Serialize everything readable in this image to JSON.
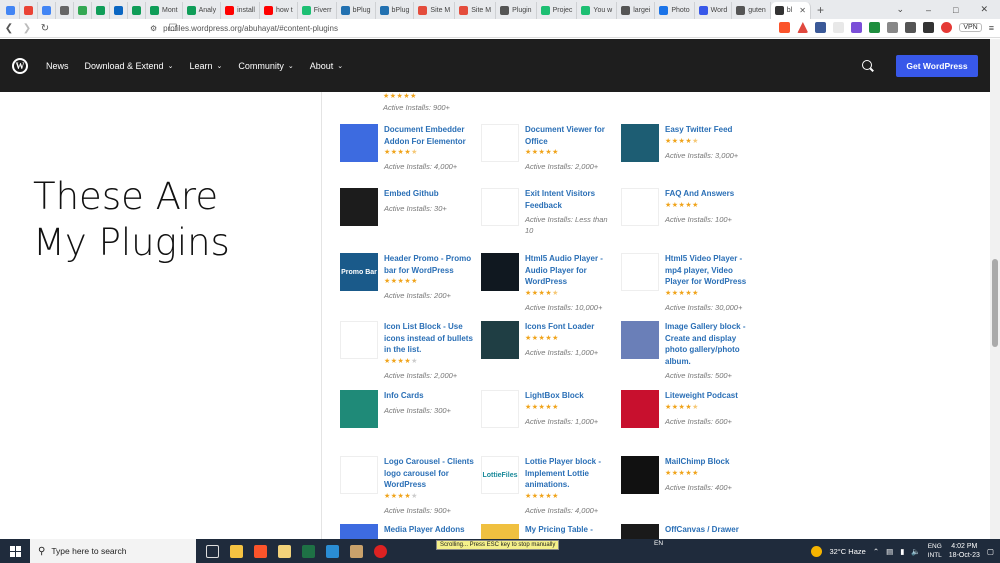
{
  "browser": {
    "tabs": [
      {
        "label": "",
        "color": "#4285f4"
      },
      {
        "label": "",
        "color": "#ea4335"
      },
      {
        "label": "",
        "color": "#4285f4"
      },
      {
        "label": "",
        "color": "#666666"
      },
      {
        "label": "",
        "color": "#34a853"
      },
      {
        "label": "",
        "color": "#0f9d58"
      },
      {
        "label": "",
        "color": "#0a66c2"
      },
      {
        "label": "",
        "color": "#0f9d58"
      },
      {
        "label": "Mont",
        "color": "#0f9d58"
      },
      {
        "label": "Analy",
        "color": "#0f9d58"
      },
      {
        "label": "install",
        "color": "#ff0000"
      },
      {
        "label": "how t",
        "color": "#ff0000"
      },
      {
        "label": "Fiverr",
        "color": "#1dbf73"
      },
      {
        "label": "bPlug",
        "color": "#2271b1"
      },
      {
        "label": "bPlug",
        "color": "#2271b1"
      },
      {
        "label": "Site M",
        "color": "#e44c3c"
      },
      {
        "label": "Site M",
        "color": "#e44c3c"
      },
      {
        "label": "Plugin",
        "color": "#555555"
      },
      {
        "label": "Projec",
        "color": "#1dbf73"
      },
      {
        "label": "You w",
        "color": "#1dbf73"
      },
      {
        "label": "largei",
        "color": "#555555"
      },
      {
        "label": "Photo",
        "color": "#1a73e8"
      },
      {
        "label": "Word",
        "color": "#3858e9"
      },
      {
        "label": "guten",
        "color": "#555555"
      },
      {
        "label": "bl",
        "color": "#333333",
        "active": true
      }
    ],
    "new_tab": "+",
    "url": "profiles.wordpress.org/abuhayat/#content-plugins",
    "vpn": "VPN"
  },
  "wp_nav": {
    "items": [
      {
        "label": "News",
        "dropdown": false
      },
      {
        "label": "Download & Extend",
        "dropdown": true
      },
      {
        "label": "Learn",
        "dropdown": true
      },
      {
        "label": "Community",
        "dropdown": true
      },
      {
        "label": "About",
        "dropdown": true
      }
    ],
    "cta": "Get WordPress"
  },
  "page": {
    "heading_line1": "These Are",
    "heading_line2": "My Plugins",
    "top_partial_installs": "Active Installs: 900+"
  },
  "plugins": [
    {
      "name": "Document Embedder Addon For Elementor",
      "stars": 4.5,
      "installs": "Active Installs: 4,000+",
      "icon": "document-embedder-icon",
      "color": "#3d6be0"
    },
    {
      "name": "Document Viewer for Office",
      "stars": 5,
      "installs": "Active Installs: 2,000+",
      "icon": "document-viewer-icon",
      "color": "#ffffff"
    },
    {
      "name": "Easy Twitter Feed",
      "stars": 4.5,
      "installs": "Active Installs: 3,000+",
      "icon": "twitter-feed-icon",
      "color": "#1d5d73"
    },
    {
      "name": "Embed Github",
      "stars": 0,
      "installs": "Active Installs: 30+",
      "icon": "github-icon",
      "color": "#1c1c1c"
    },
    {
      "name": "Exit Intent Visitors Feedback",
      "stars": 0,
      "installs": "Active Installs: Less than 10",
      "icon": "exit-intent-icon",
      "color": "#ffffff"
    },
    {
      "name": "FAQ And Answers",
      "stars": 5,
      "installs": "Active Installs: 100+",
      "icon": "faq-icon",
      "color": "#ffffff"
    },
    {
      "name": "Header Promo - Promo bar for WordPress",
      "stars": 5,
      "installs": "Active Installs: 200+",
      "icon": "promo-bar-icon",
      "color": "#1a5a8a",
      "icon_text": "Promo Bar"
    },
    {
      "name": "Html5 Audio Player - Audio Player for WordPress",
      "stars": 4.5,
      "installs": "Active Installs: 10,000+",
      "icon": "audio-player-icon",
      "color": "#101820"
    },
    {
      "name": "Html5 Video Player - mp4 player, Video Player for WordPress",
      "stars": 5,
      "installs": "Active Installs: 30,000+",
      "icon": "video-player-icon",
      "color": "#ffffff"
    },
    {
      "name": "Icon List Block - Use icons instead of bullets in the list.",
      "stars": 4,
      "installs": "Active Installs: 2,000+",
      "icon": "icon-list-icon",
      "color": "#ffffff"
    },
    {
      "name": "Icons Font Loader",
      "stars": 5,
      "installs": "Active Installs: 1,000+",
      "icon": "font-loader-icon",
      "color": "#1f3e44"
    },
    {
      "name": "Image Gallery block - Create and display photo gallery/photo album.",
      "stars": 0,
      "installs": "Active Installs: 500+",
      "icon": "image-gallery-icon",
      "color": "#6a7fb8"
    },
    {
      "name": "Info Cards",
      "stars": 0,
      "installs": "Active Installs: 300+",
      "icon": "info-cards-icon",
      "color": "#1f8a78"
    },
    {
      "name": "LightBox Block",
      "stars": 5,
      "installs": "Active Installs: 1,000+",
      "icon": "lightbox-icon",
      "color": "#ffffff"
    },
    {
      "name": "Liteweight Podcast",
      "stars": 4.5,
      "installs": "Active Installs: 600+",
      "icon": "podcast-icon",
      "color": "#c8102e"
    },
    {
      "name": "Logo Carousel - Clients logo carousel for WordPress",
      "stars": 4,
      "installs": "Active Installs: 900+",
      "icon": "logo-carousel-icon",
      "color": "#ffffff"
    },
    {
      "name": "Lottie Player block - Implement Lottie animations.",
      "stars": 5,
      "installs": "Active Installs: 4,000+",
      "icon": "lottie-icon",
      "color": "#ffffff",
      "icon_text": "LottieFiles"
    },
    {
      "name": "MailChimp Block",
      "stars": 5,
      "installs": "Active Installs: 400+",
      "icon": "mailchimp-icon",
      "color": "#111111"
    },
    {
      "name": "Media Player Addons",
      "stars": 0,
      "installs": "",
      "icon": "media-player-icon",
      "color": "#3d6be0"
    },
    {
      "name": "My Pricing Table -",
      "stars": 0,
      "installs": "",
      "icon": "pricing-table-icon",
      "color": "#f0c040"
    },
    {
      "name": "OffCanvas / Drawer",
      "stars": 0,
      "installs": "",
      "icon": "offcanvas-icon",
      "color": "#1a1a1a"
    }
  ],
  "taskbar": {
    "search_placeholder": "Type here to search",
    "scroll_tip": "Scrolling... Press ESC key to stop manually",
    "input_lang": "EN",
    "weather": "32°C  Haze",
    "lang_line1": "ENG",
    "lang_line2": "INTL",
    "time": "4:02 PM",
    "date": "18-Oct-23"
  }
}
